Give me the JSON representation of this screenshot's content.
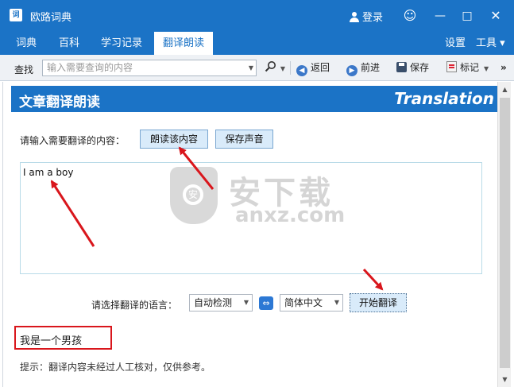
{
  "window": {
    "app_icon_text": "词",
    "title": "欧路词典",
    "login_label": "登录",
    "smile_icon": "smiley-icon",
    "minimize_glyph": "—",
    "maximize_glyph": "□",
    "close_glyph": "✕"
  },
  "menu": {
    "tabs": [
      {
        "label": "词典",
        "active": false
      },
      {
        "label": "百科",
        "active": false
      },
      {
        "label": "学习记录",
        "active": false
      },
      {
        "label": "翻译朗读",
        "active": true
      }
    ],
    "settings_label": "设置",
    "tools_label": "工具 ▾"
  },
  "toolbar": {
    "search_label": "查找",
    "search_placeholder": "输入需要查询的内容",
    "dropdown_glyph": "▼",
    "back_label": "返回",
    "forward_label": "前进",
    "save_label": "保存",
    "mark_label": "标记",
    "more_glyph": "»"
  },
  "banner": {
    "title": "文章翻译朗读",
    "english": "Translation"
  },
  "translate": {
    "prompt_label": "请输入需要翻译的内容：",
    "read_button": "朗读该内容",
    "save_voice_button": "保存声音",
    "input_text": "I am a boy",
    "lang_label": "请选择翻译的语言：",
    "source_lang": "自动检测",
    "target_lang": "简体中文",
    "swap_glyph": "⇔",
    "translate_button": "开始翻译",
    "result": "我是一个男孩",
    "hint": "提示：翻译内容未经过人工核对，仅供参考。"
  },
  "watermark": {
    "shield_text": "安",
    "cn": "安下载",
    "en": "anxz.com"
  },
  "colors": {
    "brand_blue": "#1b73c6",
    "annotation_red": "#d9161c"
  }
}
